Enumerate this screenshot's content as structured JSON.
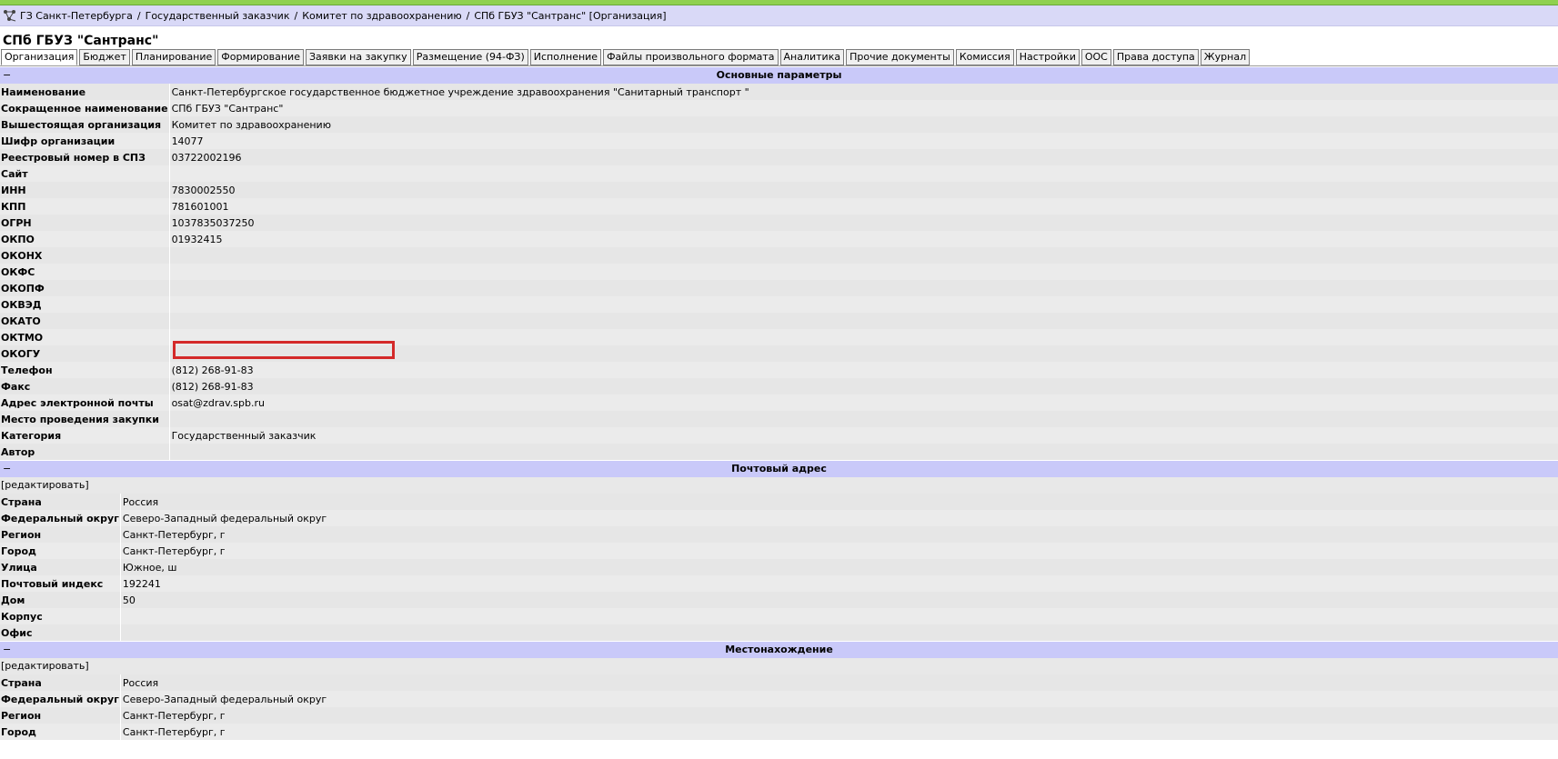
{
  "breadcrumb": {
    "items": [
      "ГЗ Санкт-Петербурга",
      "Государственный заказчик",
      "Комитет по здравоохранению",
      "СПб ГБУЗ \"Сантранс\" [Организация]"
    ],
    "separator": "/"
  },
  "org_title": "СПб ГБУЗ \"Сантранс\"",
  "tabs": [
    "Организация",
    "Бюджет",
    "Планирование",
    "Формирование",
    "Заявки на закупку",
    "Размещение (94-ФЗ)",
    "Исполнение",
    "Файлы произвольного формата",
    "Аналитика",
    "Прочие документы",
    "Комиссия",
    "Настройки",
    "ООС",
    "Права доступа",
    "Журнал"
  ],
  "main_section": {
    "toggle": "−",
    "title": "Основные параметры",
    "rows": [
      {
        "label": "Наименование",
        "value": "Санкт-Петербургское государственное бюджетное учреждение здравоохранения \"Санитарный транспорт \""
      },
      {
        "label": "Сокращенное наименование",
        "value": "СПб ГБУЗ \"Сантранс\""
      },
      {
        "label": "Вышестоящая организация",
        "value": "Комитет по здравоохранению"
      },
      {
        "label": "Шифр организации",
        "value": "14077"
      },
      {
        "label": "Реестровый номер в СПЗ",
        "value": "03722002196"
      },
      {
        "label": "Сайт",
        "value": ""
      },
      {
        "label": "ИНН",
        "value": "7830002550"
      },
      {
        "label": "КПП",
        "value": "781601001"
      },
      {
        "label": "ОГРН",
        "value": "1037835037250"
      },
      {
        "label": "ОКПО",
        "value": "01932415"
      },
      {
        "label": "ОКОНХ",
        "value": ""
      },
      {
        "label": "ОКФС",
        "value": ""
      },
      {
        "label": "ОКОПФ",
        "value": ""
      },
      {
        "label": "ОКВЭД",
        "value": ""
      },
      {
        "label": "ОКАТО",
        "value": ""
      },
      {
        "label": "ОКТМО",
        "value": ""
      },
      {
        "label": "ОКОГУ",
        "value": ""
      },
      {
        "label": "Телефон",
        "value": "(812) 268-91-83"
      },
      {
        "label": "Факс",
        "value": "(812) 268-91-83"
      },
      {
        "label": "Адрес электронной почты",
        "value": "osat@zdrav.spb.ru"
      },
      {
        "label": "Место проведения закупки",
        "value": ""
      },
      {
        "label": "Категория",
        "value": "Государственный заказчик"
      },
      {
        "label": "Автор",
        "value": ""
      }
    ]
  },
  "postal_section": {
    "toggle": "−",
    "title": "Почтовый адрес",
    "edit": "[редактировать]",
    "rows": [
      {
        "label": "Страна",
        "value": "Россия"
      },
      {
        "label": "Федеральный округ",
        "value": "Северо-Западный федеральный округ"
      },
      {
        "label": "Регион",
        "value": "Санкт-Петербург, г"
      },
      {
        "label": "Город",
        "value": "Санкт-Петербург, г"
      },
      {
        "label": "Улица",
        "value": "Южное, ш"
      },
      {
        "label": "Почтовый индекс",
        "value": "192241"
      },
      {
        "label": "Дом",
        "value": "50"
      },
      {
        "label": "Корпус",
        "value": ""
      },
      {
        "label": "Офис",
        "value": ""
      }
    ]
  },
  "location_section": {
    "toggle": "−",
    "title": "Местонахождение",
    "edit": "[редактировать]",
    "rows": [
      {
        "label": "Страна",
        "value": "Россия"
      },
      {
        "label": "Федеральный округ",
        "value": "Северо-Западный федеральный округ"
      },
      {
        "label": "Регион",
        "value": "Санкт-Петербург, г"
      },
      {
        "label": "Город",
        "value": "Санкт-Петербург, г"
      }
    ]
  },
  "colors": {
    "header_bar": "#c9c9f9",
    "breadcrumb_bar": "#d9d9f7",
    "highlight": "#d42a2a",
    "top_strip": "#8fd14f"
  }
}
